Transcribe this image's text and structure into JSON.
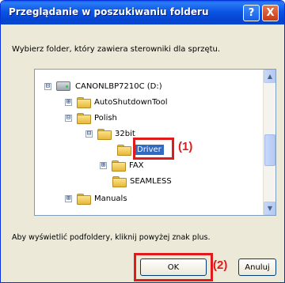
{
  "dialog": {
    "title": "Przeglądanie w poszukiwaniu folderu",
    "help_button": "?",
    "close_button": "X"
  },
  "instruction": "Wybierz folder, który zawiera sterowniki dla sprzętu.",
  "tree": {
    "items": [
      {
        "label": "CANONLBP7210C (D:)",
        "type": "drive",
        "expander": "⊟"
      },
      {
        "label": "AutoShutdownTool",
        "type": "folder",
        "expander": "⊞"
      },
      {
        "label": "Polish",
        "type": "folder",
        "expander": "⊟"
      },
      {
        "label": "32bit",
        "type": "folder",
        "expander": "⊟"
      },
      {
        "label": "Driver",
        "type": "folder",
        "expander": "",
        "selected": true
      },
      {
        "label": "FAX",
        "type": "folder",
        "expander": "⊞"
      },
      {
        "label": "SEAMLESS",
        "type": "folder",
        "expander": ""
      },
      {
        "label": "Manuals",
        "type": "folder",
        "expander": "⊞"
      }
    ]
  },
  "callouts": {
    "first": "(1)",
    "second": "(2)"
  },
  "hint": "Aby wyświetlić podfoldery, kliknij powyżej znak plus.",
  "buttons": {
    "ok": "OK",
    "cancel": "Anuluj"
  },
  "colors": {
    "titlebar": "#0b55e4",
    "highlight": "#e01b1b",
    "selection": "#316ac5"
  }
}
